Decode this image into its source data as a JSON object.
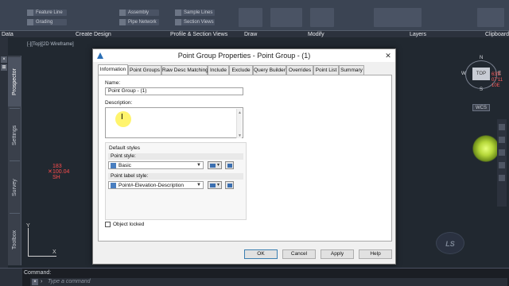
{
  "ribbon": {
    "tools": [
      {
        "label": "Feature Line"
      },
      {
        "label": "Grading"
      },
      {
        "label": "Assembly"
      },
      {
        "label": "Pipe Network"
      },
      {
        "label": "Sample Lines"
      },
      {
        "label": "Section Views"
      }
    ],
    "panels": [
      "Data",
      "Create Design",
      "Profile & Section Views",
      "Draw",
      "Modify",
      "Layers",
      "Clipboard"
    ]
  },
  "viewport": {
    "label": "[-][Top][2D Wireframe]",
    "close_glyph": "×",
    "point": {
      "number": "183",
      "elevation": "100.04",
      "description": "SH"
    },
    "ucs": {
      "x": "X",
      "y": "Y"
    }
  },
  "toolspace_tabs": [
    "Prospector",
    "Settings",
    "Survey",
    "Toolbox"
  ],
  "navigation": {
    "compass": {
      "north": "N",
      "south": "S",
      "east": "E",
      "west": "W"
    },
    "viewcube_face": "TOP",
    "wcs_label": "WCS",
    "coord_lines": [
      "63'E",
      "07'11",
      "10E"
    ]
  },
  "dialog": {
    "title": "Point Group Properties - Point Group - (1)",
    "close_glyph": "✕",
    "tabs": [
      "Information",
      "Point Groups",
      "Raw Desc Matching",
      "Include",
      "Exclude",
      "Query Builder",
      "Overrides",
      "Point List",
      "Summary"
    ],
    "active_tab": "Information",
    "name_label": "Name:",
    "name_value": "Point Group - (1)",
    "description_label": "Description:",
    "description_value": "",
    "default_styles_label": "Default styles",
    "point_style_label": "Point style:",
    "point_style_value": "Basic",
    "point_label_style_label": "Point label style:",
    "point_label_style_value": "Point#-Elevation-Description",
    "object_locked_label": "Object locked",
    "object_locked": false,
    "buttons": {
      "ok": "OK",
      "cancel": "Cancel",
      "apply": "Apply",
      "help": "Help"
    }
  },
  "command": {
    "label": "Command:",
    "placeholder": "Type a command",
    "close_glyph": "×",
    "prompt_glyph": "›"
  },
  "logo_text": "LS"
}
